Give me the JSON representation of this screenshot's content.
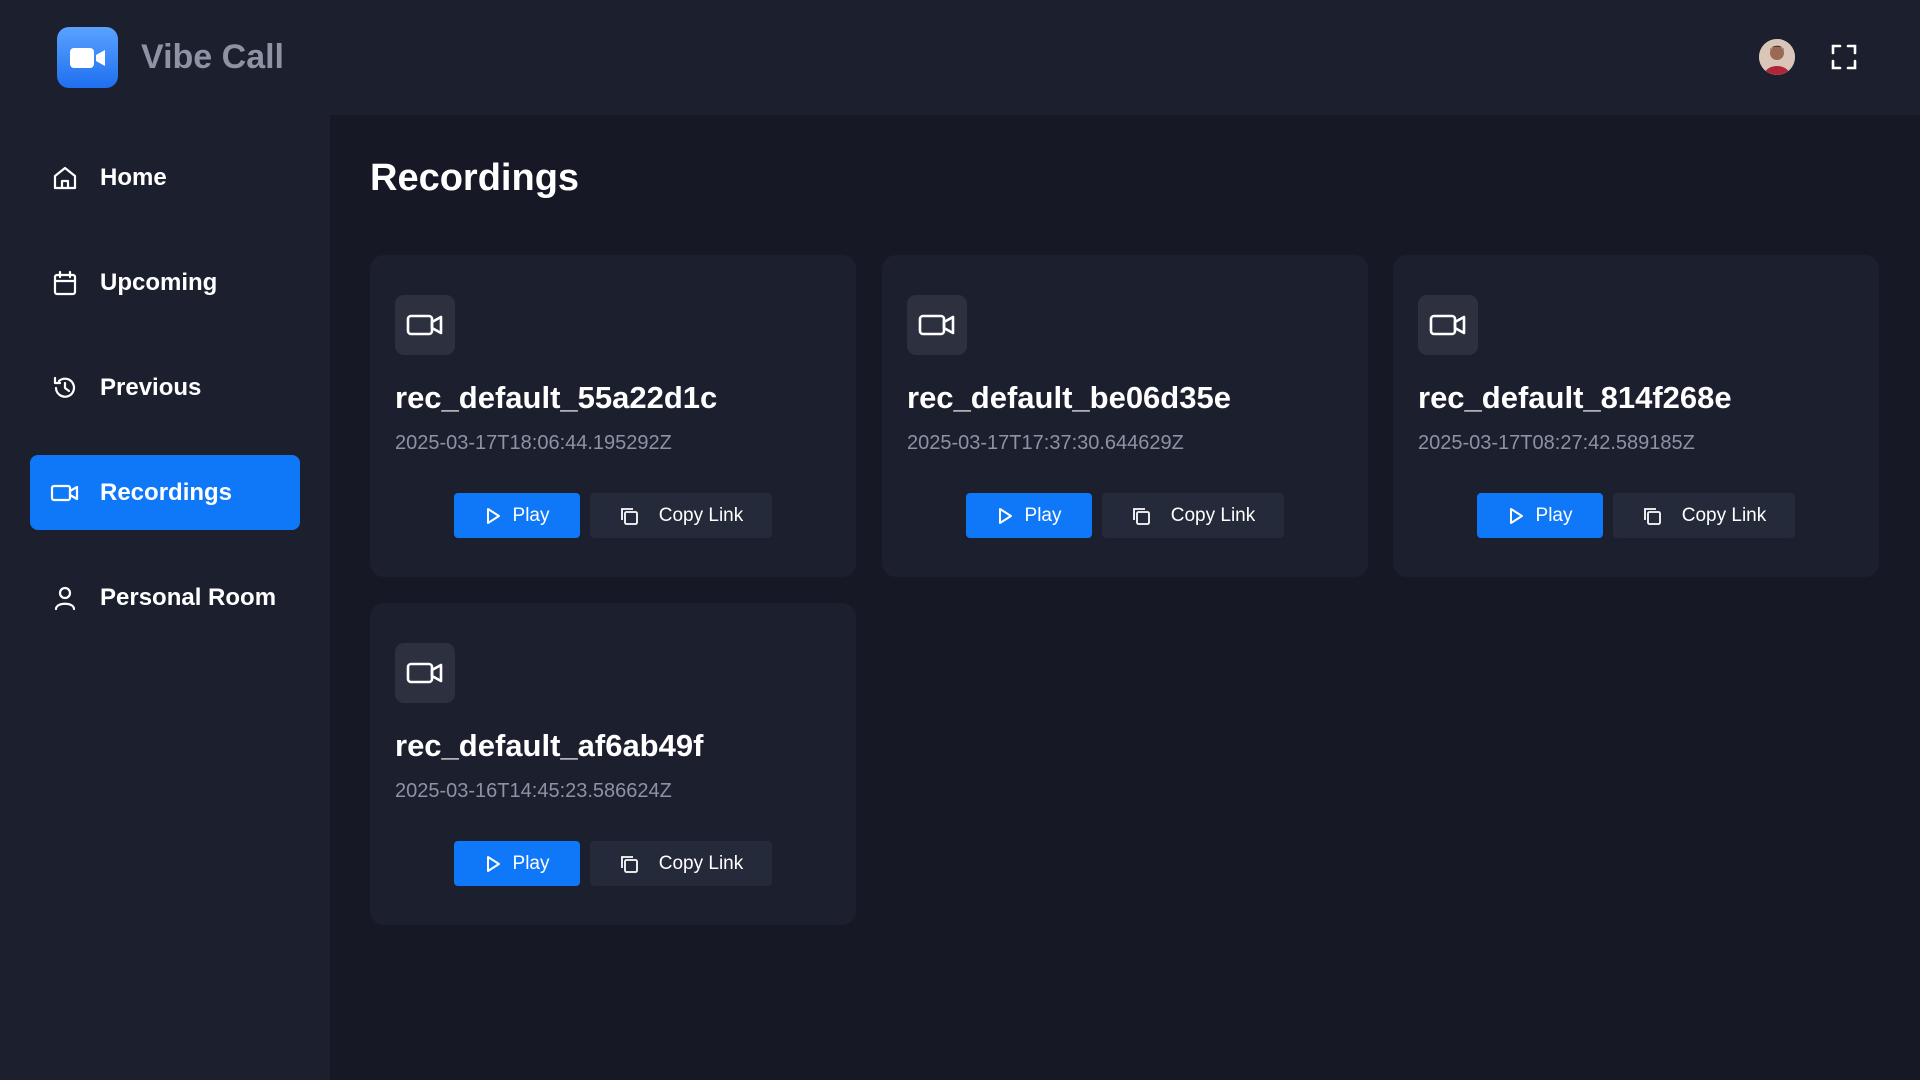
{
  "app": {
    "name": "Vibe Call"
  },
  "header": {
    "avatar_icon": "user-avatar",
    "fullscreen_icon": "fullscreen-icon"
  },
  "sidebar": {
    "items": [
      {
        "label": "Home",
        "icon": "home-icon",
        "active": false
      },
      {
        "label": "Upcoming",
        "icon": "calendar-icon",
        "active": false
      },
      {
        "label": "Previous",
        "icon": "history-icon",
        "active": false
      },
      {
        "label": "Recordings",
        "icon": "video-icon",
        "active": true
      },
      {
        "label": "Personal Room",
        "icon": "user-icon",
        "active": false
      }
    ]
  },
  "main": {
    "title": "Recordings",
    "recordings": [
      {
        "name": "rec_default_55a22d1c",
        "timestamp": "2025-03-17T18:06:44.195292Z",
        "play_label": "Play",
        "copy_label": "Copy Link"
      },
      {
        "name": "rec_default_be06d35e",
        "timestamp": "2025-03-17T17:37:30.644629Z",
        "play_label": "Play",
        "copy_label": "Copy Link"
      },
      {
        "name": "rec_default_814f268e",
        "timestamp": "2025-03-17T08:27:42.589185Z",
        "play_label": "Play",
        "copy_label": "Copy Link"
      },
      {
        "name": "rec_default_af6ab49f",
        "timestamp": "2025-03-16T14:45:23.586624Z",
        "play_label": "Play",
        "copy_label": "Copy Link"
      }
    ]
  },
  "colors": {
    "background": "#161925",
    "panel": "#1c1f2e",
    "accent": "#0e78f9",
    "secondary_button": "#252a3a",
    "muted_text": "#8d93a4"
  }
}
